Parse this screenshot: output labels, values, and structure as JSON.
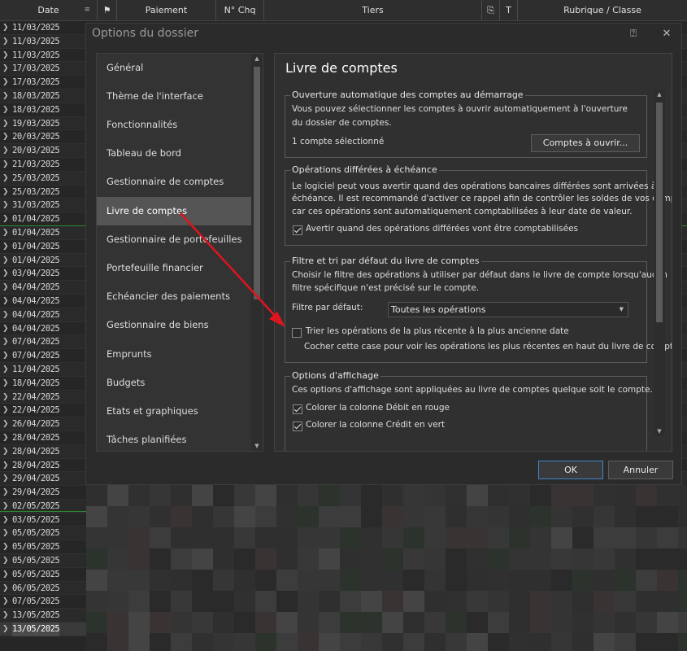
{
  "grid": {
    "headers": [
      "Date",
      "Paiement",
      "N° Chq",
      "Tiers",
      "T",
      "Rubrique / Classe"
    ],
    "dates": [
      "11/03/2025",
      "11/03/2025",
      "11/03/2025",
      "17/03/2025",
      "17/03/2025",
      "18/03/2025",
      "18/03/2025",
      "19/03/2025",
      "20/03/2025",
      "20/03/2025",
      "21/03/2025",
      "25/03/2025",
      "25/03/2025",
      "31/03/2025",
      "01/04/2025",
      "01/04/2025",
      "01/04/2025",
      "01/04/2025",
      "03/04/2025",
      "04/04/2025",
      "04/04/2025",
      "04/04/2025",
      "04/04/2025",
      "07/04/2025",
      "07/04/2025",
      "11/04/2025",
      "18/04/2025",
      "22/04/2025",
      "22/04/2025",
      "26/04/2025",
      "28/04/2025",
      "28/04/2025",
      "28/04/2025",
      "29/04/2025",
      "29/04/2025",
      "02/05/2025",
      "03/05/2025",
      "05/05/2025",
      "05/05/2025",
      "05/05/2025",
      "05/05/2025",
      "06/05/2025",
      "07/05/2025",
      "13/05/2025",
      "13/05/2025"
    ]
  },
  "dialog": {
    "title": "Options du dossier",
    "help_glyph": "⍰",
    "close_glyph": "✕",
    "nav": [
      "Général",
      "Thème de l'interface",
      "Fonctionnalités",
      "Tableau de bord",
      "Gestionnaire de comptes",
      "Livre de comptes",
      "Gestionnaire de portefeuilles",
      "Portefeuille financier",
      "Echéancier des paiements",
      "Gestionnaire de biens",
      "Emprunts",
      "Budgets",
      "Etats et graphiques",
      "Tâches planifiées"
    ],
    "active_nav": "Livre de comptes",
    "panel_title": "Livre de comptes",
    "group1": {
      "legend": "Ouverture automatique des comptes au démarrage",
      "line1": "Vous pouvez sélectionner les comptes à ouvrir automatiquement à l'ouverture",
      "line2": "du dossier de comptes.",
      "selected": "1 compte sélectionné",
      "button": "Comptes à ouvrir..."
    },
    "group2": {
      "legend": "Opérations différées à échéance",
      "line1": "Le logiciel peut vous avertir quand des opérations bancaires différées sont arrivées à",
      "line2": "échéance. Il est recommandé d'activer ce rappel afin de contrôler les soldes de vos comptes",
      "line3": "car ces opérations sont automatiquement comptabilisées à leur date de valeur.",
      "checkbox": "Avertir quand des opérations différées vont être comptabilisées"
    },
    "group3": {
      "legend": "Filtre et tri par défaut du livre de comptes",
      "line1": "Choisir le filtre des opérations à utiliser par défaut dans le livre de compte lorsqu'aucun",
      "line2": "filtre spécifique n'est précisé sur le compte.",
      "filter_label": "Filtre par défaut:",
      "filter_value": "Toutes les opérations",
      "checkbox": "Trier les opérations de la plus récente à la plus ancienne date",
      "hint": "Cocher cette case pour voir les opérations les plus récentes en haut du livre de comptes"
    },
    "group4": {
      "legend": "Options d'affichage",
      "line1": "Ces options d'affichage sont appliquées au livre de comptes quelque soit le compte.",
      "cb1": "Colorer la colonne Débit en rouge",
      "cb2": "Colorer la colonne Crédit en vert"
    },
    "ok": "OK",
    "cancel": "Annuler"
  },
  "colors": {
    "accent": "#3f84c8",
    "arrow": "#e0141e",
    "green_line": "#2e8b2e"
  }
}
